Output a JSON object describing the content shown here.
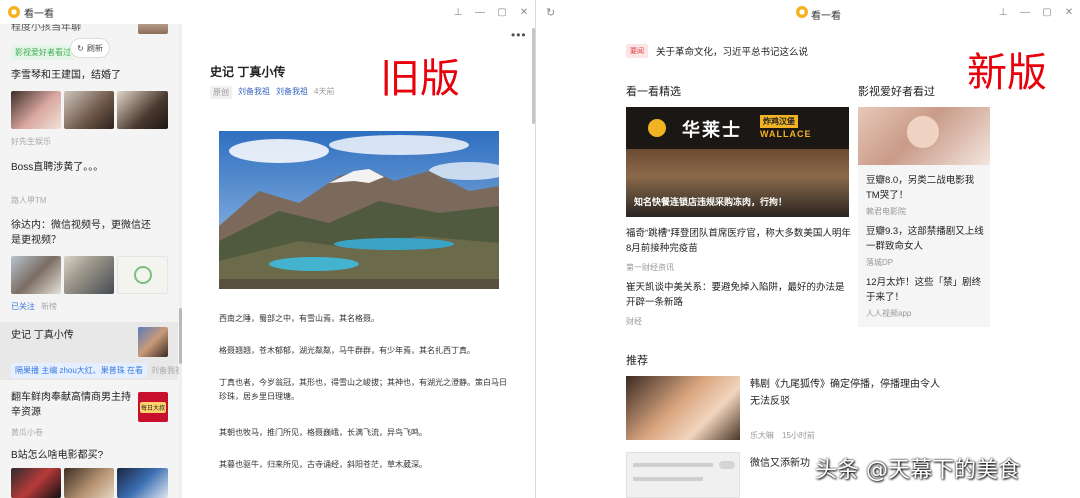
{
  "app_title": "看一看",
  "labels": {
    "old": "旧版",
    "new": "新版"
  },
  "watermark": "头条 @天幕下的美食",
  "old": {
    "window_controls": [
      "⊥",
      "—",
      "▢",
      "✕"
    ],
    "sidebar": {
      "top_cut_title": "程度小孩当年聊",
      "tag_green": "影视爱好者看过",
      "refresh_label": "刷新",
      "items": [
        {
          "title": "李雪琴和王建国，结婚了",
          "meta": "好先生娱乐"
        },
        {
          "title": "Boss直聘涉黄了。。。",
          "meta": "路人甲TM"
        },
        {
          "title": "徐达内：微信视频号，更微信还是更视频？",
          "meta_tag": "已关注",
          "meta": "新榜"
        },
        {
          "title": "史记 丁真小传",
          "tag": "隔果播 主编 zhou大红、果普珠 在看",
          "meta": "刘备我祖",
          "selected": true
        },
        {
          "title": "翻车鲜肉奉献高情商男主持辛资源",
          "meta": "黄瓜小卷",
          "thumb_text": "每日大叔"
        },
        {
          "title": "B站怎么啥电影都买?",
          "meta": ""
        }
      ]
    },
    "article": {
      "title": "史记 丁真小传",
      "meta_tag": "原创",
      "meta_author": "刘备我祖",
      "meta_source": "刘备我祖",
      "meta_time": "4天前",
      "paragraphs": [
        "西南之陲，蜀部之中，有雪山焉，其名格聂。",
        "格聂翘翘，苍木郁郁，湖光粼粼，马牛群群，有少年焉，其名扎西丁真。",
        "丁真也者，今岁翁冠，其形也，得雪山之峻拔；其神也，有湖光之澄静。策白马日珍珠，居乡里日理塘。",
        "其朝也牧马，推门所见，格聂巍峨，长满飞流，异鸟飞鸣。",
        "其暮也驱牛，归来所见，古寺诵经，斜阳苍茫，草木葳深。"
      ]
    }
  },
  "new": {
    "window_controls": [
      "⊥",
      "—",
      "▢",
      "✕"
    ],
    "hot": {
      "badge": "要闻",
      "text": "关于革命文化，习近平总书记这么说"
    },
    "featured": {
      "section": "看一看精选",
      "image_caption": "知名快餐连锁店违规采购冻肉，行拘！",
      "brand": "华莱士",
      "brand_sub": "炸鸡汉堡",
      "brand_en": "WALLACE",
      "items": [
        {
          "title": "福奇“跳槽”拜登团队首席医疗官，称大多数美国人明年8月前接种完疫苗",
          "source": "第一财经资讯"
        },
        {
          "title": "崔天凯谈中美关系：要避免掉入陷阱，最好的办法是开辟一条新路",
          "source": "财经"
        }
      ]
    },
    "film": {
      "section": "影视爱好者看过",
      "items": [
        {
          "title": "豆瓣8.0，另类二战电影我TM哭了！",
          "source": "赖君电影院"
        },
        {
          "title": "豆瓣9.3，这部禁播剧又上线一群致命女人",
          "source": "落城DP"
        },
        {
          "title": "12月太炸！这些「禁」剧终于来了！",
          "source": "人人视频app"
        }
      ]
    },
    "recommend": {
      "section": "推荐",
      "items": [
        {
          "title": "韩剧《九尾狐传》确定停播，停播理由令人无法反驳",
          "source": "乐大嘛",
          "time": "15小时前"
        },
        {
          "title": "微信又添新功",
          "source": ""
        }
      ]
    }
  }
}
